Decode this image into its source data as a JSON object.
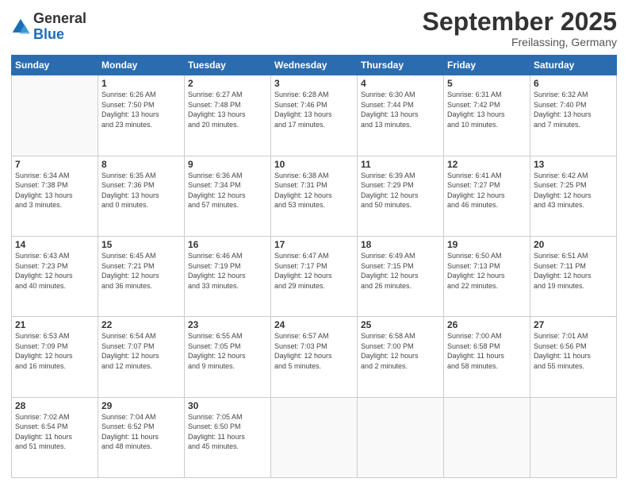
{
  "header": {
    "logo": {
      "general": "General",
      "blue": "Blue"
    },
    "month": "September 2025",
    "location": "Freilassing, Germany"
  },
  "weekdays": [
    "Sunday",
    "Monday",
    "Tuesday",
    "Wednesday",
    "Thursday",
    "Friday",
    "Saturday"
  ],
  "weeks": [
    [
      {
        "day": "",
        "info": ""
      },
      {
        "day": "1",
        "info": "Sunrise: 6:26 AM\nSunset: 7:50 PM\nDaylight: 13 hours\nand 23 minutes."
      },
      {
        "day": "2",
        "info": "Sunrise: 6:27 AM\nSunset: 7:48 PM\nDaylight: 13 hours\nand 20 minutes."
      },
      {
        "day": "3",
        "info": "Sunrise: 6:28 AM\nSunset: 7:46 PM\nDaylight: 13 hours\nand 17 minutes."
      },
      {
        "day": "4",
        "info": "Sunrise: 6:30 AM\nSunset: 7:44 PM\nDaylight: 13 hours\nand 13 minutes."
      },
      {
        "day": "5",
        "info": "Sunrise: 6:31 AM\nSunset: 7:42 PM\nDaylight: 13 hours\nand 10 minutes."
      },
      {
        "day": "6",
        "info": "Sunrise: 6:32 AM\nSunset: 7:40 PM\nDaylight: 13 hours\nand 7 minutes."
      }
    ],
    [
      {
        "day": "7",
        "info": "Sunrise: 6:34 AM\nSunset: 7:38 PM\nDaylight: 13 hours\nand 3 minutes."
      },
      {
        "day": "8",
        "info": "Sunrise: 6:35 AM\nSunset: 7:36 PM\nDaylight: 13 hours\nand 0 minutes."
      },
      {
        "day": "9",
        "info": "Sunrise: 6:36 AM\nSunset: 7:34 PM\nDaylight: 12 hours\nand 57 minutes."
      },
      {
        "day": "10",
        "info": "Sunrise: 6:38 AM\nSunset: 7:31 PM\nDaylight: 12 hours\nand 53 minutes."
      },
      {
        "day": "11",
        "info": "Sunrise: 6:39 AM\nSunset: 7:29 PM\nDaylight: 12 hours\nand 50 minutes."
      },
      {
        "day": "12",
        "info": "Sunrise: 6:41 AM\nSunset: 7:27 PM\nDaylight: 12 hours\nand 46 minutes."
      },
      {
        "day": "13",
        "info": "Sunrise: 6:42 AM\nSunset: 7:25 PM\nDaylight: 12 hours\nand 43 minutes."
      }
    ],
    [
      {
        "day": "14",
        "info": "Sunrise: 6:43 AM\nSunset: 7:23 PM\nDaylight: 12 hours\nand 40 minutes."
      },
      {
        "day": "15",
        "info": "Sunrise: 6:45 AM\nSunset: 7:21 PM\nDaylight: 12 hours\nand 36 minutes."
      },
      {
        "day": "16",
        "info": "Sunrise: 6:46 AM\nSunset: 7:19 PM\nDaylight: 12 hours\nand 33 minutes."
      },
      {
        "day": "17",
        "info": "Sunrise: 6:47 AM\nSunset: 7:17 PM\nDaylight: 12 hours\nand 29 minutes."
      },
      {
        "day": "18",
        "info": "Sunrise: 6:49 AM\nSunset: 7:15 PM\nDaylight: 12 hours\nand 26 minutes."
      },
      {
        "day": "19",
        "info": "Sunrise: 6:50 AM\nSunset: 7:13 PM\nDaylight: 12 hours\nand 22 minutes."
      },
      {
        "day": "20",
        "info": "Sunrise: 6:51 AM\nSunset: 7:11 PM\nDaylight: 12 hours\nand 19 minutes."
      }
    ],
    [
      {
        "day": "21",
        "info": "Sunrise: 6:53 AM\nSunset: 7:09 PM\nDaylight: 12 hours\nand 16 minutes."
      },
      {
        "day": "22",
        "info": "Sunrise: 6:54 AM\nSunset: 7:07 PM\nDaylight: 12 hours\nand 12 minutes."
      },
      {
        "day": "23",
        "info": "Sunrise: 6:55 AM\nSunset: 7:05 PM\nDaylight: 12 hours\nand 9 minutes."
      },
      {
        "day": "24",
        "info": "Sunrise: 6:57 AM\nSunset: 7:03 PM\nDaylight: 12 hours\nand 5 minutes."
      },
      {
        "day": "25",
        "info": "Sunrise: 6:58 AM\nSunset: 7:00 PM\nDaylight: 12 hours\nand 2 minutes."
      },
      {
        "day": "26",
        "info": "Sunrise: 7:00 AM\nSunset: 6:58 PM\nDaylight: 11 hours\nand 58 minutes."
      },
      {
        "day": "27",
        "info": "Sunrise: 7:01 AM\nSunset: 6:56 PM\nDaylight: 11 hours\nand 55 minutes."
      }
    ],
    [
      {
        "day": "28",
        "info": "Sunrise: 7:02 AM\nSunset: 6:54 PM\nDaylight: 11 hours\nand 51 minutes."
      },
      {
        "day": "29",
        "info": "Sunrise: 7:04 AM\nSunset: 6:52 PM\nDaylight: 11 hours\nand 48 minutes."
      },
      {
        "day": "30",
        "info": "Sunrise: 7:05 AM\nSunset: 6:50 PM\nDaylight: 11 hours\nand 45 minutes."
      },
      {
        "day": "",
        "info": ""
      },
      {
        "day": "",
        "info": ""
      },
      {
        "day": "",
        "info": ""
      },
      {
        "day": "",
        "info": ""
      }
    ]
  ]
}
